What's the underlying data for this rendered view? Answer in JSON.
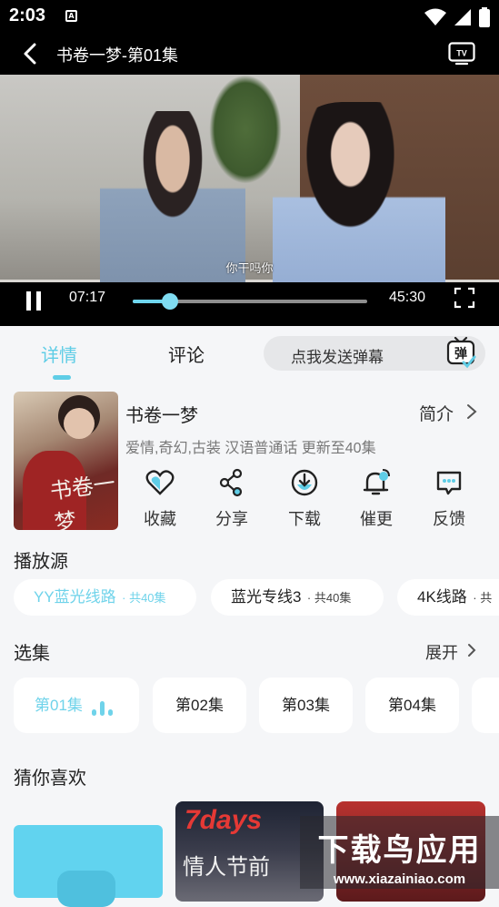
{
  "status_bar": {
    "time": "2:03",
    "notification_letter": "A"
  },
  "header": {
    "title": "书卷一梦-第01集"
  },
  "player": {
    "subtitle": "你干吗你",
    "current_time": "07:17",
    "total_time": "45:30",
    "progress": 0.16
  },
  "tabs": [
    {
      "label": "详情",
      "active": true
    },
    {
      "label": "评论",
      "active": false
    }
  ],
  "danmu": {
    "placeholder": "点我发送弹幕",
    "icon_label": "弹"
  },
  "show": {
    "poster_text": "书卷一梦",
    "title": "书卷一梦",
    "intro_label": "简介",
    "tags": "爱情,奇幻,古装 汉语普通话 更新至40集"
  },
  "actions": [
    {
      "label": "收藏",
      "icon": "heart-icon"
    },
    {
      "label": "分享",
      "icon": "share-icon"
    },
    {
      "label": "下载",
      "icon": "download-icon"
    },
    {
      "label": "催更",
      "icon": "bell-icon"
    },
    {
      "label": "反馈",
      "icon": "feedback-icon"
    }
  ],
  "sources": {
    "title": "播放源",
    "items": [
      {
        "name": "YY蓝光线路",
        "count": "· 共40集",
        "active": true
      },
      {
        "name": "蓝光专线3",
        "count": "· 共40集",
        "active": false
      },
      {
        "name": "4K线路",
        "count": "· 共",
        "active": false
      }
    ]
  },
  "episodes": {
    "title": "选集",
    "expand_label": "展开",
    "items": [
      {
        "label": "第01集",
        "active": true
      },
      {
        "label": "第02集",
        "active": false
      },
      {
        "label": "第03集",
        "active": false
      },
      {
        "label": "第04集",
        "active": false
      }
    ]
  },
  "recommend": {
    "title": "猜你喜欢",
    "items": [
      {
        "text": ""
      },
      {
        "title": "7days",
        "subtitle": "情人节前"
      },
      {
        "text": ""
      }
    ]
  },
  "watermark": {
    "main": "下载鸟应用",
    "url": "www.xiazainiao.com"
  },
  "colors": {
    "accent": "#5fcde6",
    "background": "#f5f6f8",
    "dark": "#000000"
  }
}
